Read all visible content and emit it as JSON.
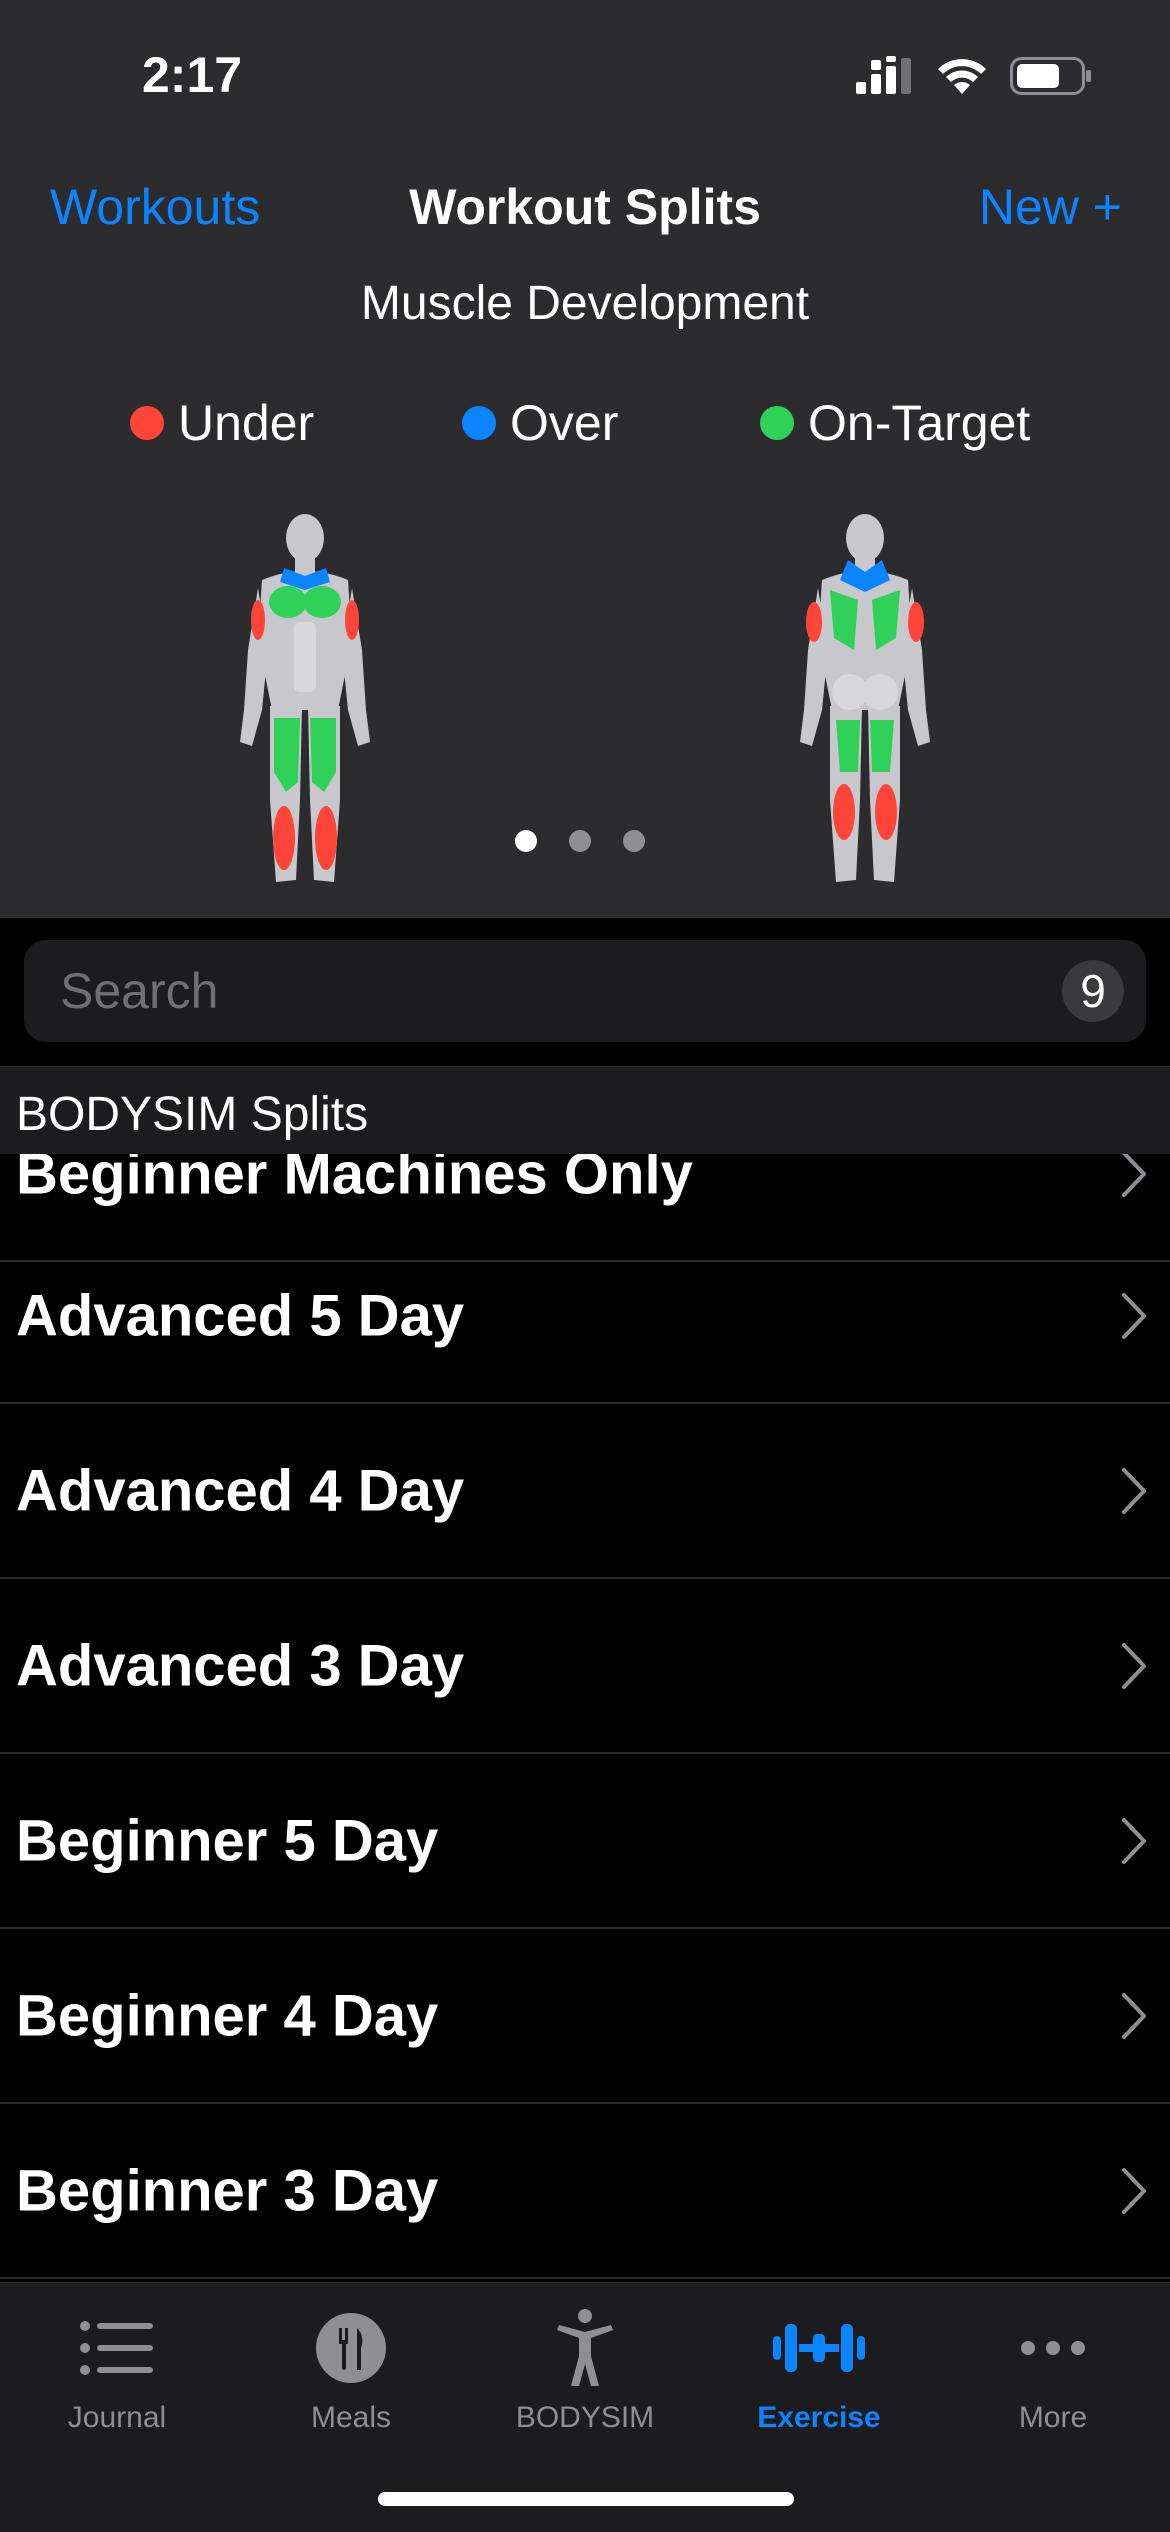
{
  "status_bar": {
    "time": "2:17"
  },
  "nav": {
    "back_label": "Workouts",
    "title": "Workout Splits",
    "new_label": "New +"
  },
  "subtitle": "Muscle Development",
  "legend": [
    {
      "label": "Under",
      "color": "#ff453a"
    },
    {
      "label": "Over",
      "color": "#0a84ff"
    },
    {
      "label": "On-Target",
      "color": "#30d158"
    }
  ],
  "pager": {
    "pages": 3,
    "current": 1
  },
  "search": {
    "placeholder": "Search",
    "count": "9"
  },
  "section_title": "BODYSIM Splits",
  "list": {
    "partial_item": "Beginner Machines Only",
    "items": [
      {
        "label": "Advanced 5 Day"
      },
      {
        "label": "Advanced 4 Day"
      },
      {
        "label": "Advanced 3 Day"
      },
      {
        "label": "Beginner 5 Day"
      },
      {
        "label": "Beginner 4 Day"
      },
      {
        "label": "Beginner 3 Day"
      }
    ]
  },
  "tabs": [
    {
      "label": "Journal",
      "icon": "list-icon",
      "active": false
    },
    {
      "label": "Meals",
      "icon": "fork-knife-icon",
      "active": false
    },
    {
      "label": "BODYSIM",
      "icon": "person-icon",
      "active": false
    },
    {
      "label": "Exercise",
      "icon": "dumbbell-icon",
      "active": true
    },
    {
      "label": "More",
      "icon": "ellipsis-icon",
      "active": false
    }
  ],
  "colors": {
    "accent": "#0a84ff",
    "under": "#ff453a",
    "over": "#0a84ff",
    "on_target": "#30d158",
    "panel": "#2c2c2e"
  }
}
